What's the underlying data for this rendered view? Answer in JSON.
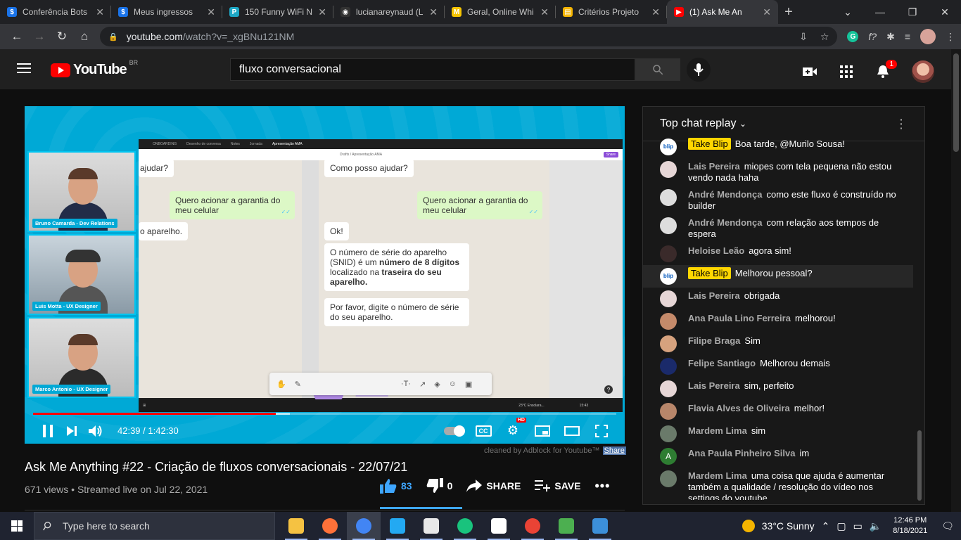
{
  "browser": {
    "tabs": [
      {
        "title": "Conferência Bots",
        "favicon_color": "#1a73e8",
        "favicon_glyph": "$"
      },
      {
        "title": "Meus ingressos",
        "favicon_color": "#1a73e8",
        "favicon_glyph": "$"
      },
      {
        "title": "150 Funny WiFi N",
        "favicon_color": "#1ea7c5",
        "favicon_glyph": "P"
      },
      {
        "title": "lucianareynaud (L",
        "favicon_color": "#333333",
        "favicon_glyph": "◉"
      },
      {
        "title": "Geral, Online Whi",
        "favicon_color": "#f5c400",
        "favicon_glyph": "M"
      },
      {
        "title": "Critérios Projeto",
        "favicon_color": "#f4b400",
        "favicon_glyph": "▤"
      },
      {
        "title": "(1) Ask Me An",
        "favicon_color": "#ff0000",
        "favicon_glyph": "▶",
        "active": true
      }
    ],
    "url_host": "youtube.com",
    "url_path": "/watch?v=_xgBNu121NM"
  },
  "youtube": {
    "logo_text": "YouTube",
    "country": "BR",
    "search_value": "fluxo conversacional",
    "notif_count": "1"
  },
  "video": {
    "title": "Ask Me Anything #22 - Criação de fluxos conversacionais - 22/07/21",
    "views": "671 views",
    "streamed": "Streamed live on Jul 22, 2021",
    "likes": "83",
    "dislikes": "0",
    "share_label": "SHARE",
    "save_label": "SAVE",
    "time_current": "42:39",
    "time_total": "1:42:30",
    "progress_fraction": 0.416,
    "buffer_fraction": 0.44,
    "adblock_text": "cleaned by Adblock for Youtube™",
    "adblock_share": "Share",
    "hd_badge": "HD",
    "cc_label": "CC",
    "cameras": [
      {
        "label": "Bruno Camarda - Dev Relations"
      },
      {
        "label": "Luis Motta - UX Designer"
      },
      {
        "label": "Marco Antonio - UX Designer"
      }
    ],
    "screen": {
      "tabs": [
        "ONBOARDING",
        "Desenho de conversa",
        "Notes",
        "Jornada",
        "Apresentação AMA"
      ],
      "doc_path": "Drafts / Apresentação AMA",
      "share": "Share",
      "left_top": "ajudar?",
      "left_out": "Quero acionar a garantia do meu celular",
      "left_in": "o aparelho.",
      "right_top": "Como posso ajudar?",
      "right_out": "Quero acionar a garantia do meu celular",
      "right_ok": "Ok!",
      "serial_1": "O número de série do aparelho (SNID) é um ",
      "serial_bold1": "número de 8 dígitos",
      "serial_2": " localizado na ",
      "serial_bold2": "traseira do seu aparelho.",
      "ask": "Por favor, digite o número de série do seu aparelho.",
      "weather": "23°C Ensolara...",
      "time": "15:43"
    }
  },
  "chat": {
    "header": "Top chat replay",
    "messages": [
      {
        "author": "Take Blip",
        "owner": true,
        "text": "Boa tarde, @Murilo Sousa!",
        "av": "#ffffff"
      },
      {
        "author": "Lais Pereira",
        "text": "miopes com tela pequena não estou vendo nada haha",
        "av": "#e6d6d6"
      },
      {
        "author": "André Mendonça",
        "text": "como este fluxo é construído no builder",
        "av": "#dddddd"
      },
      {
        "author": "André Mendonça",
        "text": "com relação aos tempos de espera",
        "av": "#dddddd"
      },
      {
        "author": "Heloise Leão",
        "text": "agora sim!",
        "av": "#3a2a2a"
      },
      {
        "author": "Take Blip",
        "owner": true,
        "text": "Melhorou pessoal?",
        "av": "#ffffff",
        "hl": true
      },
      {
        "author": "Lais Pereira",
        "text": "obrigada",
        "av": "#e6d6d6"
      },
      {
        "author": "Ana Paula Lino Ferreira",
        "text": "melhorou!",
        "av": "#c58a6a"
      },
      {
        "author": "Filipe Braga",
        "text": "Sim",
        "av": "#d6a27e"
      },
      {
        "author": "Felipe Santiago",
        "text": "Melhorou demais",
        "av": "#1a2a6a"
      },
      {
        "author": "Lais Pereira",
        "text": "sim, perfeito",
        "av": "#e6d6d6"
      },
      {
        "author": "Flavia Alves de Oliveira",
        "text": "melhor!",
        "av": "#b8866a"
      },
      {
        "author": "Mardem Lima",
        "text": "sim",
        "av": "#6a7a6a"
      },
      {
        "author": "Ana Paula Pinheiro Silva",
        "text": "im",
        "av": "#2e7d32",
        "initial": "A"
      },
      {
        "author": "Mardem Lima",
        "text": "uma coisa que ajuda é aumentar também a qualidade / resolução do vídeo nos settings do youtube",
        "av": "#6a7a6a"
      }
    ]
  },
  "taskbar": {
    "search_placeholder": "Type here to search",
    "weather": "33°C  Sunny",
    "time": "12:46 PM",
    "date": "8/18/2021",
    "apps": [
      {
        "name": "file-explorer",
        "color": "#f5c242"
      },
      {
        "name": "firefox",
        "color": "#ff7139"
      },
      {
        "name": "chrome",
        "color": "#4285f4",
        "active": true
      },
      {
        "name": "vscode",
        "color": "#23a9f2"
      },
      {
        "name": "paint",
        "color": "#e8e8e8"
      },
      {
        "name": "chatgpt",
        "color": "#19c37d"
      },
      {
        "name": "notion",
        "color": "#ffffff"
      },
      {
        "name": "chrome-profile",
        "color": "#ea4335"
      },
      {
        "name": "git-kraken",
        "color": "#4caf50"
      },
      {
        "name": "photos",
        "color": "#3c8fd9"
      }
    ]
  }
}
